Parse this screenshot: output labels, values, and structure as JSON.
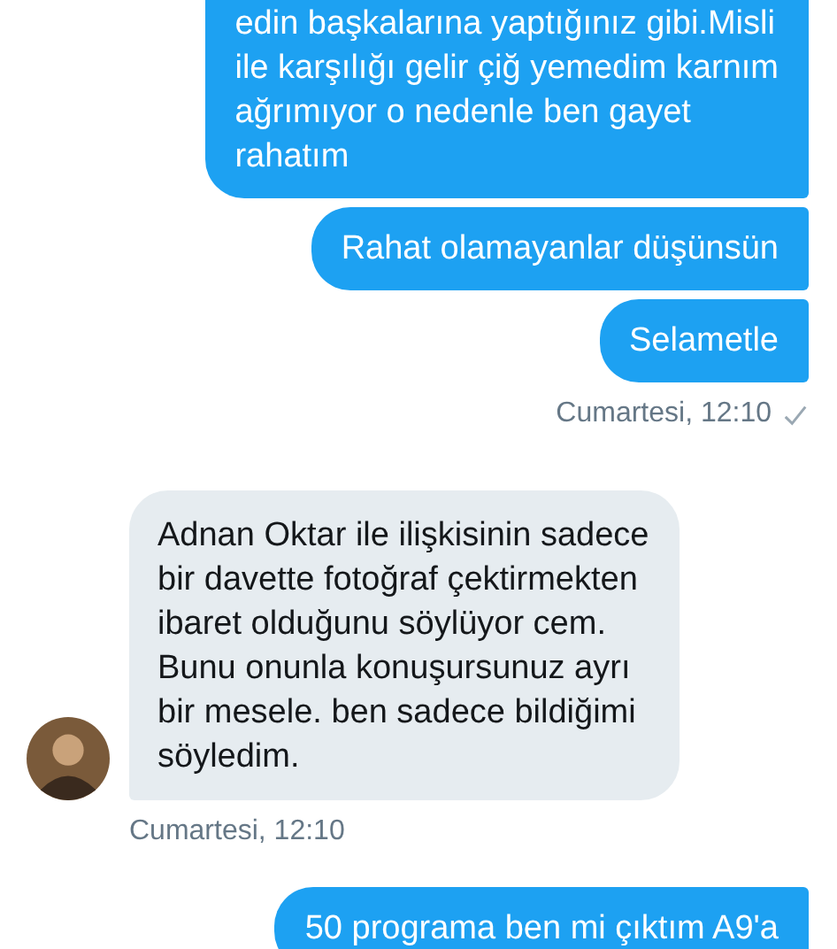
{
  "messages": [
    {
      "kind": "sent",
      "text": "edin başkalarına yaptığınız gibi.Misli\nile karşılığı gelir çiğ yemedim karnım\nağrımıyor o nedenle ben gayet\nrahatım"
    },
    {
      "kind": "sent",
      "text": "Rahat olamayanlar düşünsün"
    },
    {
      "kind": "sent",
      "text": "Selametle"
    },
    {
      "kind": "sent_time",
      "text": "Cumartesi, 12:10",
      "delivered": true
    },
    {
      "kind": "received",
      "text": "Adnan Oktar ile ilişkisinin sadece\nbir davette fotoğraf çektirmekten\nibaret olduğunu söylüyor cem.\nBunu onunla konuşursunuz ayrı\nbir mesele. ben sadece bildiğimi\nsöyledim."
    },
    {
      "kind": "received_time",
      "text": "Cumartesi, 12:10",
      "delivered": false
    },
    {
      "kind": "sent",
      "text": "50 programa ben mi çıktım A9'a"
    }
  ]
}
